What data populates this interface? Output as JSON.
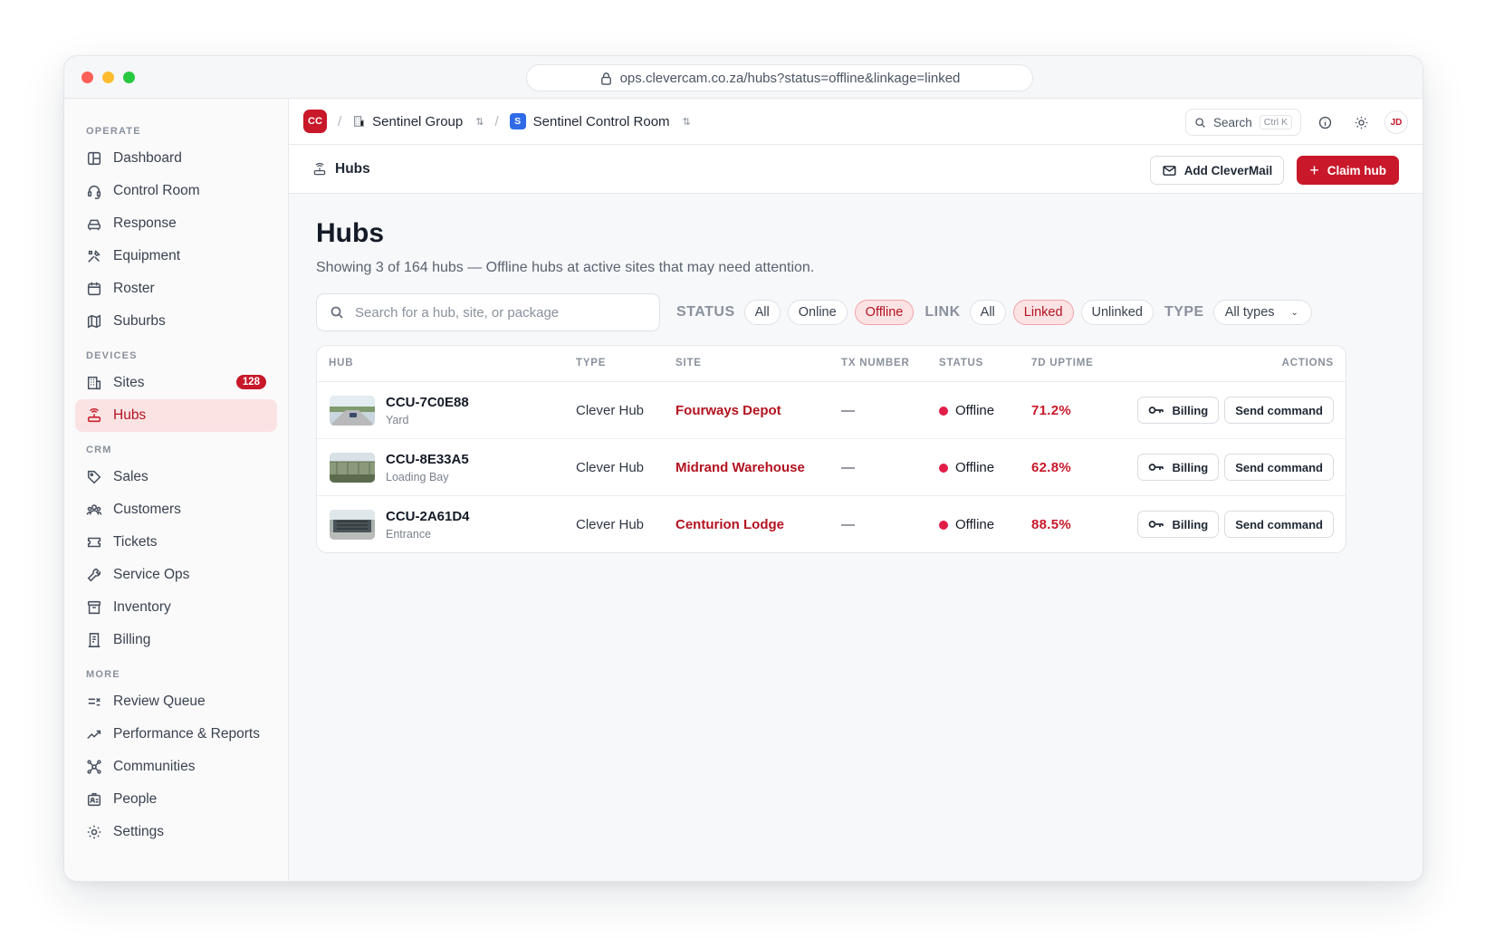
{
  "browser": {
    "url": "ops.clevercam.co.za/hubs?status=offline&linkage=linked"
  },
  "sidebar": {
    "sections": [
      {
        "label": "OPERATE",
        "items": [
          {
            "label": "Dashboard",
            "icon": "dashboard-icon"
          },
          {
            "label": "Control Room",
            "icon": "headset-icon"
          },
          {
            "label": "Response",
            "icon": "car-icon"
          },
          {
            "label": "Equipment",
            "icon": "tools-icon"
          },
          {
            "label": "Roster",
            "icon": "calendar-icon"
          },
          {
            "label": "Suburbs",
            "icon": "map-icon"
          }
        ]
      },
      {
        "label": "DEVICES",
        "items": [
          {
            "label": "Sites",
            "icon": "building-icon",
            "badge": "128"
          },
          {
            "label": "Hubs",
            "icon": "router-icon",
            "active": true
          }
        ]
      },
      {
        "label": "CRM",
        "items": [
          {
            "label": "Sales",
            "icon": "tag-icon"
          },
          {
            "label": "Customers",
            "icon": "users-icon"
          },
          {
            "label": "Tickets",
            "icon": "ticket-icon"
          },
          {
            "label": "Service Ops",
            "icon": "wrench-icon"
          },
          {
            "label": "Inventory",
            "icon": "archive-icon"
          },
          {
            "label": "Billing",
            "icon": "receipt-icon"
          }
        ]
      },
      {
        "label": "MORE",
        "items": [
          {
            "label": "Review Queue",
            "icon": "review-icon"
          },
          {
            "label": "Performance & Reports",
            "icon": "trend-icon"
          },
          {
            "label": "Communities",
            "icon": "network-icon"
          },
          {
            "label": "People",
            "icon": "id-badge-icon"
          },
          {
            "label": "Settings",
            "icon": "gear-icon"
          }
        ]
      }
    ]
  },
  "topbar": {
    "org_badge": "CC",
    "org_name": "Sentinel Group",
    "workspace_badge": "S",
    "workspace_name": "Sentinel Control Room",
    "search_label": "Search",
    "search_shortcut": "Ctrl K",
    "avatar_initials": "JD"
  },
  "pagebar": {
    "title": "Hubs",
    "add_clevermail_label": "Add CleverMail",
    "claim_hub_label": "Claim hub"
  },
  "main": {
    "heading": "Hubs",
    "subtitle": "Showing 3 of 164 hubs — Offline hubs at active sites that may need attention.",
    "search_placeholder": "Search for a hub, site, or package",
    "filters": {
      "status_label": "STATUS",
      "status_options": [
        "All",
        "Online",
        "Offline"
      ],
      "status_selected": "Offline",
      "link_label": "LINK",
      "link_options": [
        "All",
        "Linked",
        "Unlinked"
      ],
      "link_selected": "Linked",
      "type_label": "TYPE",
      "type_value": "All types"
    }
  },
  "table": {
    "headers": [
      "HUB",
      "TYPE",
      "SITE",
      "TX NUMBER",
      "STATUS",
      "7D UPTIME",
      "ACTIONS"
    ],
    "rows": [
      {
        "hub": "CCU-7C0E88",
        "location": "Yard",
        "type": "Clever Hub",
        "site": "Fourways Depot",
        "tx": "—",
        "status": "Offline",
        "uptime": "71.2%",
        "billing": "Billing",
        "command": "Send command"
      },
      {
        "hub": "CCU-8E33A5",
        "location": "Loading Bay",
        "type": "Clever Hub",
        "site": "Midrand Warehouse",
        "tx": "—",
        "status": "Offline",
        "uptime": "62.8%",
        "billing": "Billing",
        "command": "Send command"
      },
      {
        "hub": "CCU-2A61D4",
        "location": "Entrance",
        "type": "Clever Hub",
        "site": "Centurion Lodge",
        "tx": "—",
        "status": "Offline",
        "uptime": "88.5%",
        "billing": "Billing",
        "command": "Send command"
      }
    ]
  },
  "colors": {
    "accent": "#c8182a",
    "offline": "#e11d48",
    "active_bg": "#fbe3e4"
  }
}
